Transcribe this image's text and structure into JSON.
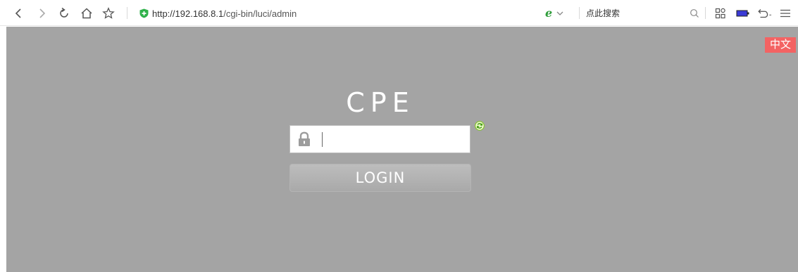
{
  "browser": {
    "url_host": "http://192.168.8.1",
    "url_path": "/cgi-bin/luci/admin",
    "engine_icon": "e",
    "search_placeholder": "点此搜索"
  },
  "page": {
    "language_button": "中文",
    "brand_title": "CPE",
    "password_value": "",
    "login_button": "LOGIN"
  },
  "colors": {
    "page_background": "#a4a4a4",
    "language_button": "#f36363",
    "secure_shield": "#2fb14a",
    "search_engine": "#2f9d3b"
  },
  "icons": {
    "back": "chevron-left-icon",
    "forward": "chevron-right-icon",
    "reload": "reload-icon",
    "home": "home-icon",
    "bookmark": "star-icon",
    "secure": "shield-icon",
    "engine_dropdown": "chevron-down-icon",
    "search": "search-icon",
    "apps": "apps-grid-icon",
    "battery": "battery-icon",
    "undo": "undo-icon",
    "menu": "menu-icon",
    "lock": "lock-icon",
    "refresh": "refresh-icon"
  }
}
